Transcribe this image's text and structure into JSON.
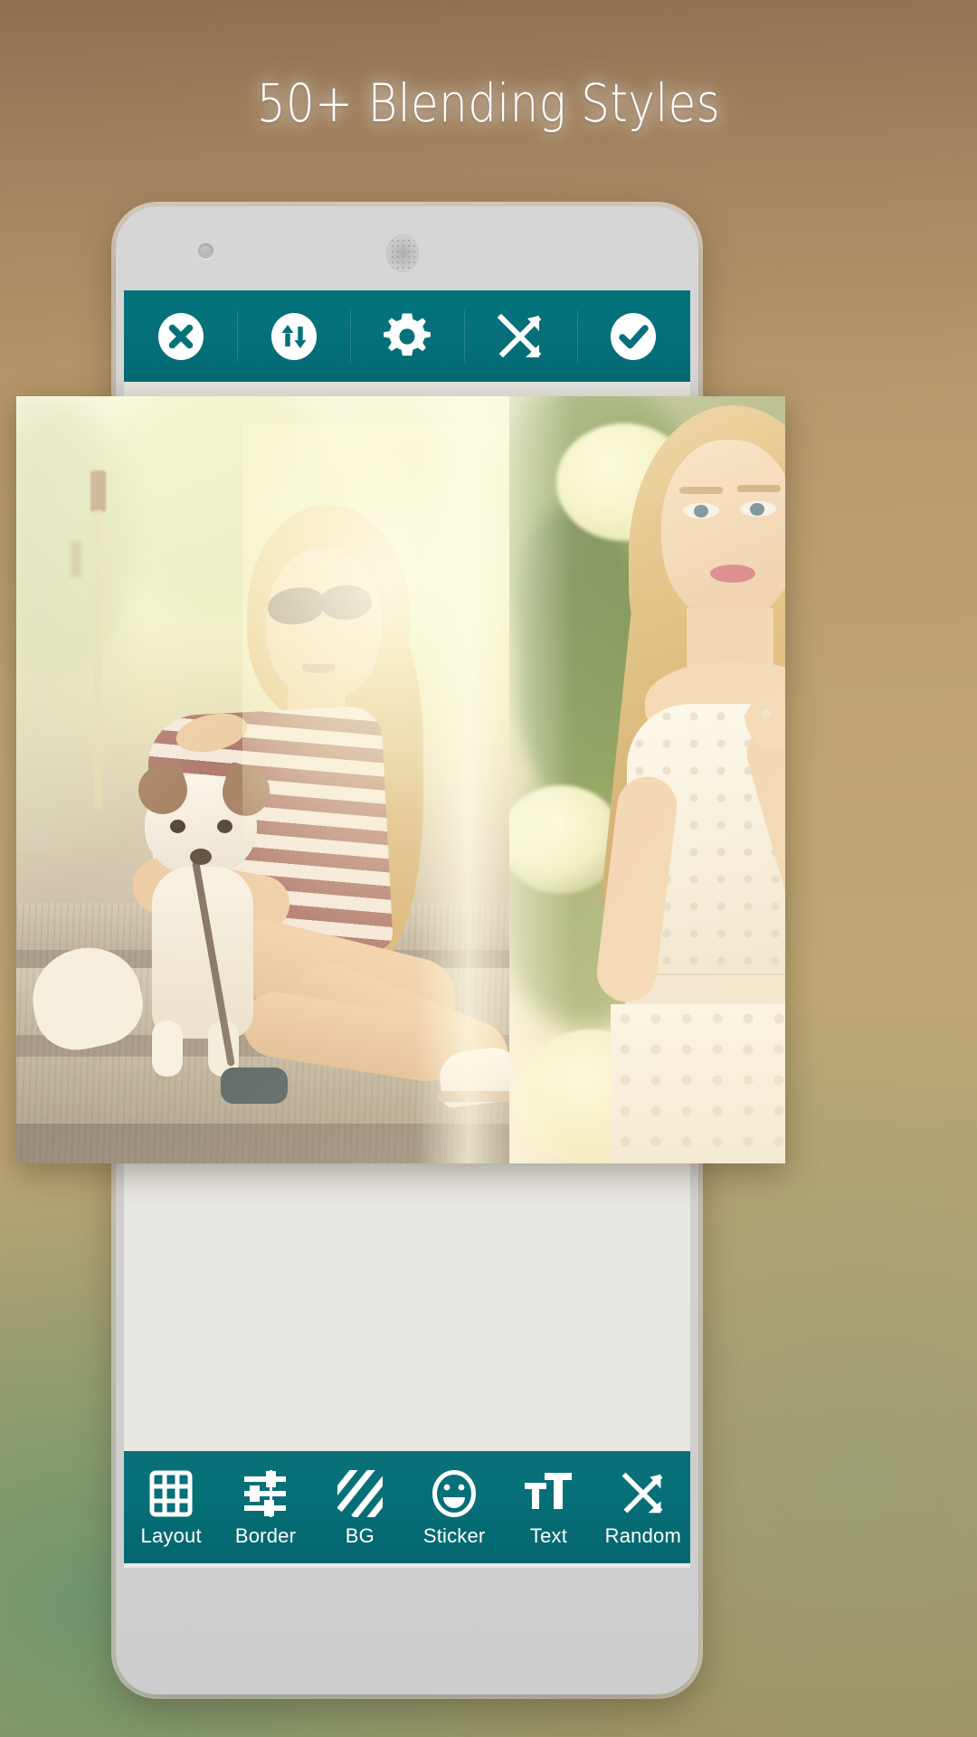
{
  "headline": "50+ Blending Styles",
  "theme": {
    "accent_teal": "#056d75",
    "toolbar_icon_color": "#ffffff",
    "phone_body": "#d2d2d2",
    "background_top": "#b79a6b",
    "background_bottom_left": "#6c966e"
  },
  "phone": {
    "camera_icon": "camera-dot-icon",
    "speaker_icon": "speaker-grille-icon"
  },
  "top_toolbar": {
    "items": [
      {
        "name": "close",
        "icon": "close-circle-icon",
        "label": "Close"
      },
      {
        "name": "swap",
        "icon": "swap-vertical-circle-icon",
        "label": "Swap"
      },
      {
        "name": "settings",
        "icon": "gear-icon",
        "label": "Settings"
      },
      {
        "name": "shuffle",
        "icon": "shuffle-icon",
        "label": "Shuffle"
      },
      {
        "name": "done",
        "icon": "check-circle-icon",
        "label": "Done"
      }
    ]
  },
  "bottom_toolbar": {
    "items": [
      {
        "label": "Layout",
        "icon": "grid-layout-icon"
      },
      {
        "label": "Border",
        "icon": "sliders-icon"
      },
      {
        "label": "BG",
        "icon": "diagonal-stripes-icon"
      },
      {
        "label": "Sticker",
        "icon": "smiley-face-icon"
      },
      {
        "label": "Text",
        "icon": "text-size-icon"
      },
      {
        "label": "Random",
        "icon": "shuffle-icon"
      }
    ]
  },
  "collage": {
    "left_photo_alt": "Woman in striped top with sunglasses sitting on stone steps beside a Jack Russell terrier",
    "right_photo_alt": "Blonde woman in a white lace dress standing in front of white hydrangea blossoms"
  }
}
